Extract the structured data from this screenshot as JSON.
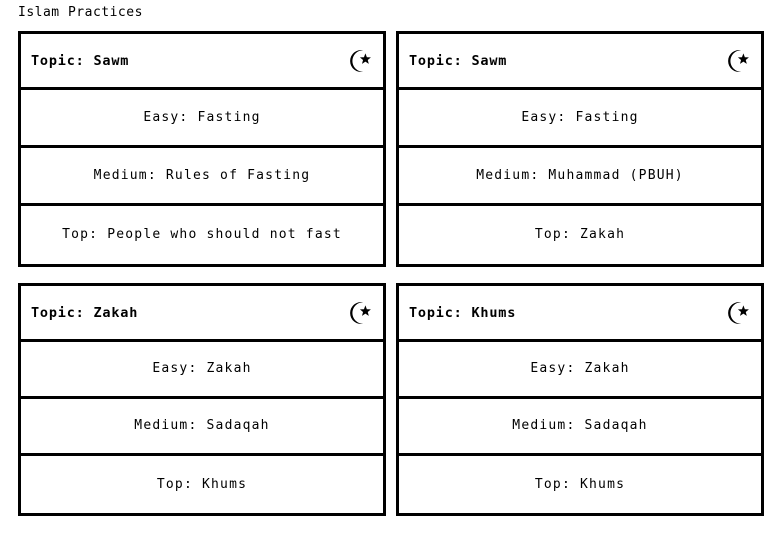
{
  "page": {
    "title": "Islam Practices",
    "background_color": "#ffffff",
    "text_color": "#000000",
    "border_color": "#000000"
  },
  "icon": {
    "name": "star-and-crescent-icon",
    "glyph": "☪"
  },
  "row_labels": {
    "easy": "Easy",
    "medium": "Medium",
    "top": "Top"
  },
  "cards": [
    {
      "header": "Topic: Sawm",
      "icon": "star-and-crescent-icon",
      "rows": [
        "Easy: Fasting",
        "Medium: Rules of Fasting",
        "Top: People who should not fast"
      ]
    },
    {
      "header": "Topic: Sawm",
      "icon": "star-and-crescent-icon",
      "rows": [
        "Easy: Fasting",
        "Medium: Muhammad (PBUH)",
        "Top: Zakah"
      ]
    },
    {
      "header": "Topic: Zakah",
      "icon": "star-and-crescent-icon",
      "rows": [
        "Easy: Zakah",
        "Medium: Sadaqah",
        "Top: Khums"
      ]
    },
    {
      "header": "Topic: Khums",
      "icon": "star-and-crescent-icon",
      "rows": [
        "Easy: Zakah",
        "Medium: Sadaqah",
        "Top: Khums"
      ]
    }
  ]
}
